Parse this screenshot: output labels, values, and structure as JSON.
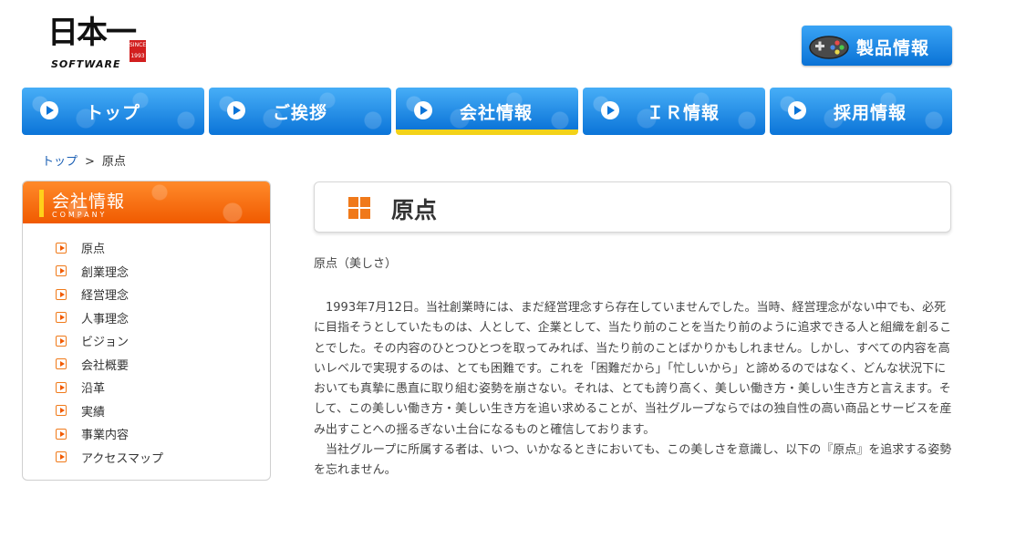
{
  "header": {
    "logo_kanji": "日本一",
    "logo_seal": "SINCE 1993",
    "logo_sub": "SOFTWARE",
    "product_button": "製品情報"
  },
  "nav": {
    "items": [
      {
        "label": "トップ"
      },
      {
        "label": "ご挨拶"
      },
      {
        "label": "会社情報"
      },
      {
        "label": "ＩＲ情報"
      },
      {
        "label": "採用情報"
      }
    ],
    "active_index": 2
  },
  "breadcrumb": {
    "home": "トップ",
    "separator": ">",
    "current": "原点"
  },
  "sidebar": {
    "title": "会社情報",
    "subtitle": "COMPANY",
    "items": [
      {
        "label": "原点"
      },
      {
        "label": "創業理念"
      },
      {
        "label": "経営理念"
      },
      {
        "label": "人事理念"
      },
      {
        "label": "ビジョン"
      },
      {
        "label": "会社概要"
      },
      {
        "label": "沿革"
      },
      {
        "label": "実績"
      },
      {
        "label": "事業内容"
      },
      {
        "label": "アクセスマップ"
      }
    ]
  },
  "main": {
    "title": "原点",
    "subtitle": "原点（美しさ）",
    "paragraph1": "　1993年7月12日。当社創業時には、まだ経営理念すら存在していませんでした。当時、経営理念がない中でも、必死に目指そうとしていたものは、人として、企業として、当たり前のことを当たり前のように追求できる人と組織を創ることでした。その内容のひとつひとつを取ってみれば、当たり前のことばかりかもしれません。しかし、すべての内容を高いレベルで実現するのは、とても困難です。これを「困難だから」「忙しいから」と諦めるのではなく、どんな状況下においても真摯に愚直に取り組む姿勢を崩さない。それは、とても誇り高く、美しい働き方・美しい生き方と言えます。そして、この美しい働き方・美しい生き方を追い求めることが、当社グループならではの独自性の高い商品とサービスを産み出すことへの揺るぎない土台になるものと確信しております。",
    "paragraph2": "　当社グループに所属する者は、いつ、いかなるときにおいても、この美しさを意識し、以下の『原点』を追求する姿勢を忘れません。"
  },
  "colors": {
    "nav_blue": "#0b74d8",
    "active_underline": "#f3d219",
    "sidebar_orange": "#f05a00",
    "title_icon": "#f0791a"
  },
  "icons": {
    "product": "gamepad-icon",
    "nav": "play-circle-icon",
    "sidebar": "arrow-right-box-icon",
    "title": "four-squares-icon"
  }
}
